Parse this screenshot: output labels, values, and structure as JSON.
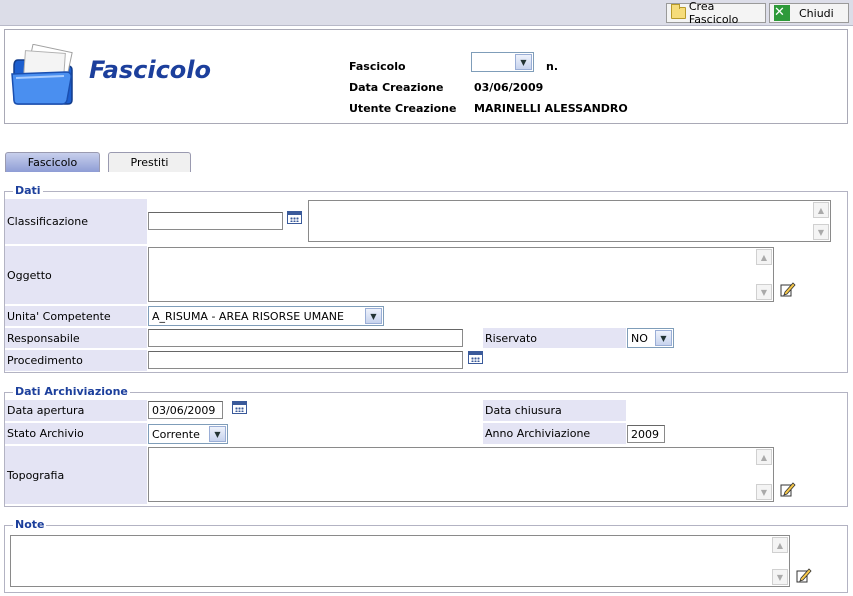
{
  "toolbar": {
    "crea_label": "Crea Fascicolo",
    "chiudi_label": "Chiudi"
  },
  "header": {
    "title": "Fascicolo",
    "fascicolo_label": "Fascicolo",
    "fascicolo_select": "",
    "n_label": "n.",
    "data_creazione_label": "Data Creazione",
    "data_creazione_value": "03/06/2009",
    "utente_creazione_label": "Utente Creazione",
    "utente_creazione_value": "MARINELLI ALESSANDRO"
  },
  "tabs": [
    {
      "label": "Fascicolo",
      "active": true
    },
    {
      "label": "Prestiti",
      "active": false
    }
  ],
  "dati": {
    "legend": "Dati",
    "classificazione_label": "Classificazione",
    "classificazione_value": "",
    "classificazione_desc": "",
    "oggetto_label": "Oggetto",
    "oggetto_value": "",
    "unita_label": "Unita' Competente",
    "unita_value": "A_RISUMA - AREA RISORSE UMANE",
    "responsabile_label": "Responsabile",
    "responsabile_value": "",
    "riservato_label": "Riservato",
    "riservato_value": "NO",
    "procedimento_label": "Procedimento",
    "procedimento_value": ""
  },
  "archiviazione": {
    "legend": "Dati Archiviazione",
    "data_apertura_label": "Data apertura",
    "data_apertura_value": "03/06/2009",
    "data_chiusura_label": "Data chiusura",
    "data_chiusura_value": "",
    "stato_label": "Stato Archivio",
    "stato_value": "Corrente",
    "anno_label": "Anno Archiviazione",
    "anno_value": "2009",
    "topografia_label": "Topografia",
    "topografia_value": ""
  },
  "note": {
    "legend": "Note",
    "value": ""
  },
  "icons": [
    "folder-icon",
    "close-x-icon",
    "folder-logo",
    "calendar-icon",
    "edit-pencil-icon",
    "scroll-up-icon",
    "scroll-down-icon",
    "dropdown-arrow-icon"
  ],
  "colors": {
    "accent": "#1c3f9c",
    "label_bg": "#e4e4f4",
    "topbar": "#dcdde8"
  }
}
